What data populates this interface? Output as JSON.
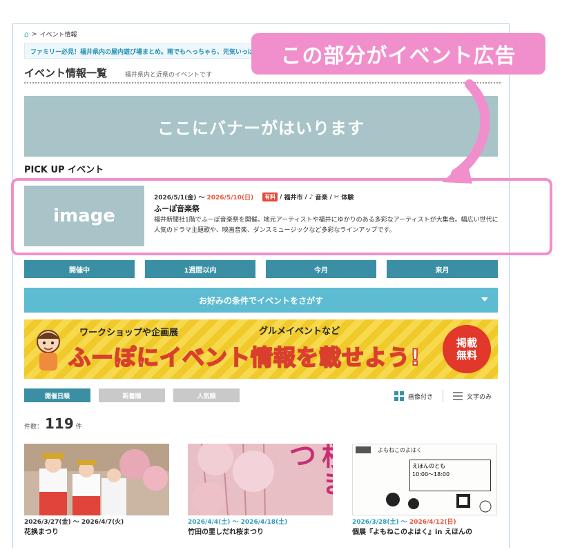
{
  "breadcrumb": {
    "current": "イベント情報",
    "sep": ">"
  },
  "notice": "ファミリー必見！福井県内の屋内遊び場まとめ。雨でもへっちゃら、元気いっぱいに遊べるスポットをご紹介",
  "header": {
    "title": "イベント情報一覧",
    "subtitle": "福井県内と近県のイベントです"
  },
  "banner": {
    "text": "ここにバナーがはいります"
  },
  "pickup": {
    "heading": "PICK UP イベント",
    "image_text": "image",
    "date_start": "2026/5/1(金) 〜",
    "date_end": "2026/5/10(日)",
    "fee": "有料",
    "sep1": "/",
    "area": "福井市",
    "sep2": "/",
    "cat1": "音楽",
    "sep3": "/",
    "cat2": "体験",
    "name": "ふーぽ音楽祭",
    "desc": "福井新聞社1階でふーぽ音楽祭を開催。地元アーティストや福井にゆかりのある多彩なアーティストが大集合。幅広い世代に人気のドラマ主題歌や、映画音楽、ダンスミュージックなど多彩なラインアップです。"
  },
  "tabs": [
    "開催中",
    "1週間以内",
    "今月",
    "来月"
  ],
  "search_label": "お好みの条件でイベントをさがす",
  "promo": {
    "sub1": "ワークショップや企画展",
    "sub2": "グルメイベントなど",
    "main": "ふーぽにイベント情報を載せよう!",
    "badge1": "掲載",
    "badge2": "無料"
  },
  "sort": [
    "開催日順",
    "新着順",
    "人気順"
  ],
  "view": {
    "image": "画像付き",
    "text": "文字のみ"
  },
  "count": {
    "label": "件数：",
    "value": "119",
    "unit": "件"
  },
  "cards": [
    {
      "date_start": "2026/3/27(金) 〜",
      "date_end": "2026/4/7(火)",
      "title": "花换まつり"
    },
    {
      "date_start": "2026/4/4(土) 〜",
      "date_end": "2026/4/18(土)",
      "title": "竹田の里しだれ桜まつり"
    },
    {
      "date_start": "2026/3/28(土) 〜",
      "date_end": "2026/4/12(日)",
      "title": "個展『よもねこのよはく』in えほんの"
    }
  ],
  "card2_overlay": "桜まつ",
  "card3": {
    "header": "よもねこのよはく",
    "place": "えほんのとも",
    "time": "10:00〜18:00"
  },
  "callout": "この部分がイベント広告",
  "colors": {
    "accent": "#3b8fa4",
    "callout": "#f08fcb",
    "banner": "#a8c4c8",
    "red": "#e4573d"
  }
}
